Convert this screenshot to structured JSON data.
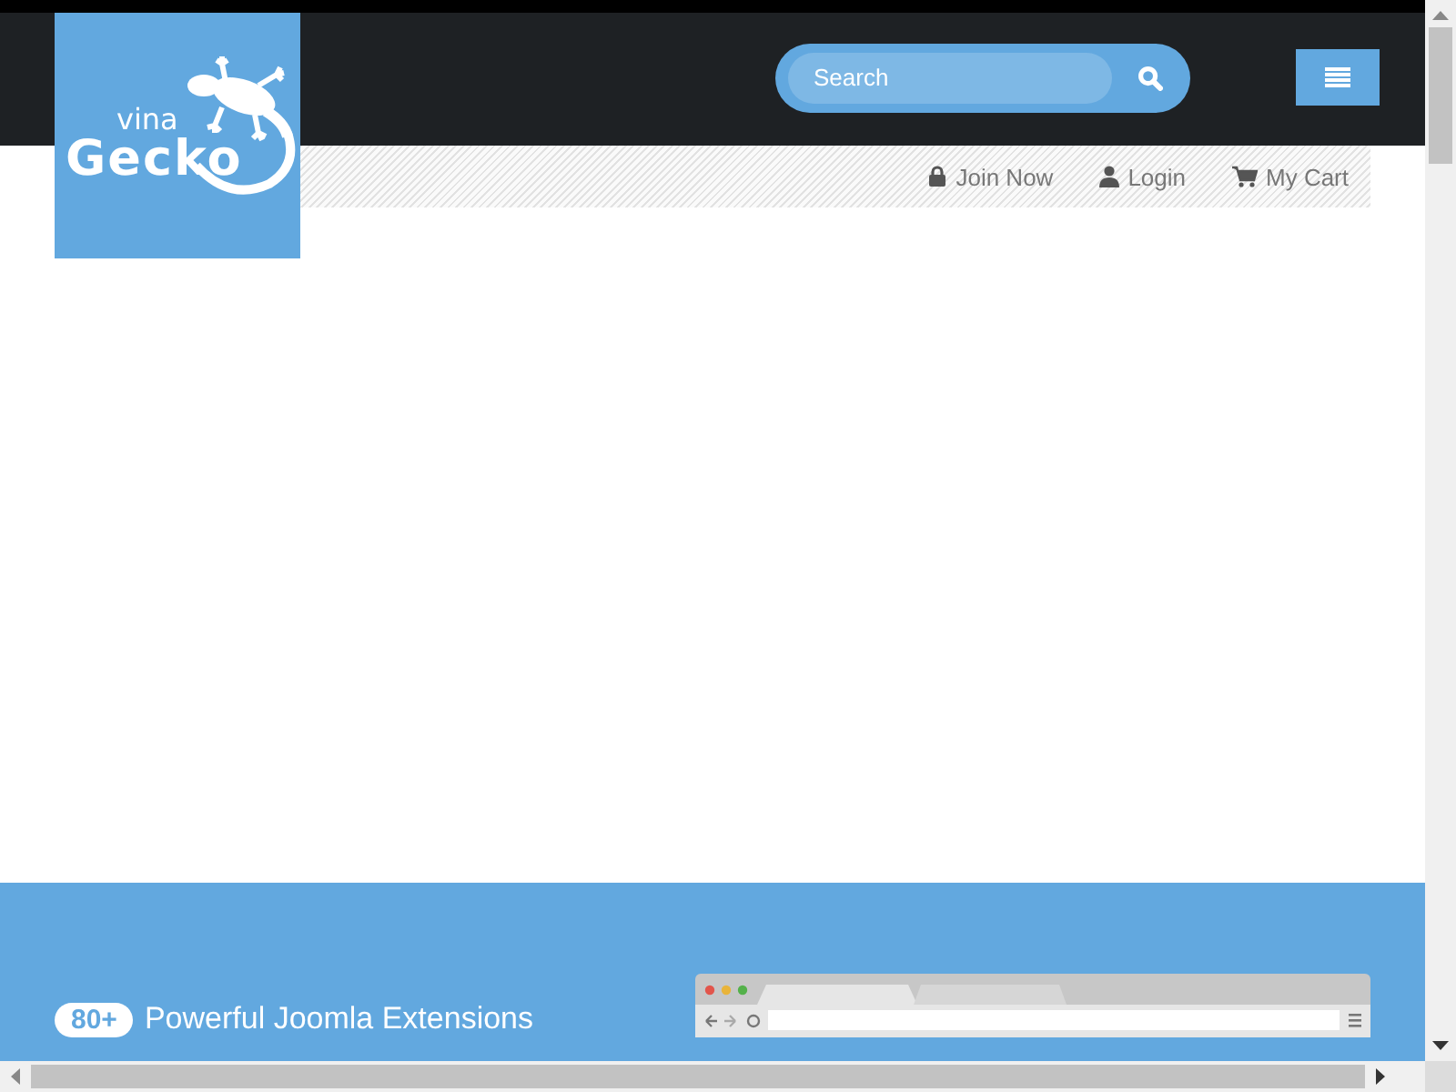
{
  "logo": {
    "line_1": "vina",
    "line_2": "Gecko"
  },
  "search": {
    "placeholder": "Search"
  },
  "top_links": [
    {
      "label": "Join Now",
      "kind": "lock"
    },
    {
      "label": "Login",
      "kind": "user"
    },
    {
      "label": "My Cart",
      "kind": "cart"
    }
  ],
  "banner": {
    "badge": "80+",
    "headline": "Powerful Joomla Extensions"
  }
}
